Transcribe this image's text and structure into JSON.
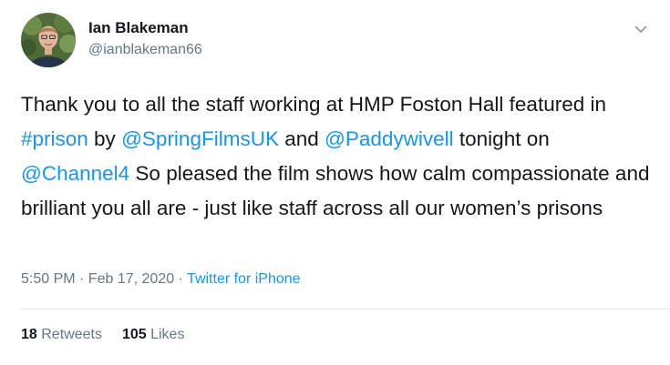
{
  "author": {
    "display_name": "Ian Blakeman",
    "handle": "@ianblakeman66",
    "avatar_icon": "profile-photo"
  },
  "tweet": {
    "segments": [
      {
        "text": "Thank you to all the staff working at HMP Foston Hall featured in ",
        "link": false
      },
      {
        "text": "#prison",
        "link": true
      },
      {
        "text": " by ",
        "link": false
      },
      {
        "text": "@SpringFilmsUK",
        "link": true
      },
      {
        "text": " and ",
        "link": false
      },
      {
        "text": "@Paddywivell",
        "link": true
      },
      {
        "text": " tonight on ",
        "link": false
      },
      {
        "text": "@Channel4",
        "link": true
      },
      {
        "text": " So pleased the film shows how calm compassionate and brilliant you all are - just like staff across all our women’s prisons",
        "link": false
      }
    ]
  },
  "meta": {
    "timestamp": "5:50 PM · Feb 17, 2020",
    "separator": " · ",
    "source": "Twitter for iPhone"
  },
  "stats": {
    "retweets_count": "18",
    "retweets_label": " Retweets",
    "likes_count": "105",
    "likes_label": " Likes"
  },
  "colors": {
    "text": "#14171a",
    "secondary": "#657786",
    "link": "#1b95e0",
    "divider": "#e6ecf0"
  },
  "icons": {
    "menu": "chevron-down-icon"
  }
}
